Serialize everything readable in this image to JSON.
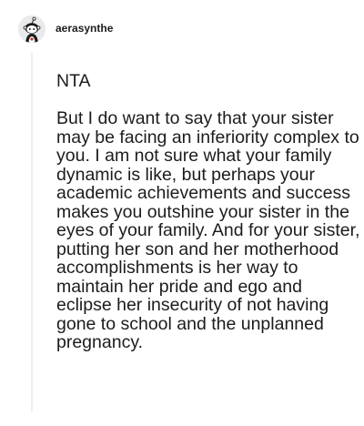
{
  "comment": {
    "username": "aerasynthe",
    "avatar_icon": "snoo-avatar-icon",
    "paragraphs": [
      "NTA",
      "But I do want to say that your sister may be facing an inferiority complex to you. I am not sure what your family dynamic is like, but perhaps your academic achievements and success makes you outshine your sister in the eyes of your family. And for your sister, putting her son and her motherhood accomplishments is her way to maintain her pride and ego and eclipse her insecurity of not having gone to school and the unplanned pregnancy."
    ]
  }
}
